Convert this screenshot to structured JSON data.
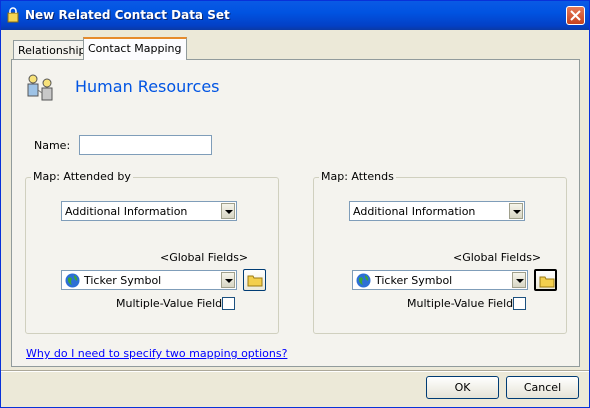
{
  "window": {
    "title": "New Related Contact Data Set",
    "close_glyph": "✕"
  },
  "tabs": [
    {
      "label": "Relationship",
      "active": false
    },
    {
      "label": "Contact Mapping",
      "active": true
    }
  ],
  "heading": "Human Resources",
  "name_field": {
    "label": "Name:",
    "value": ""
  },
  "left_group": {
    "title": "Map: Attended by",
    "combo1_value": "Additional Information",
    "fields_label": "<Global Fields>",
    "combo2_value": "Ticker Symbol",
    "multi_label": "Multiple-Value Fields",
    "multi_checked": false
  },
  "right_group": {
    "title": "Map: Attends",
    "combo1_value": "Additional Information",
    "fields_label": "<Global Fields>",
    "combo2_value": "Ticker Symbol",
    "multi_label": "Multiple-Value Fields",
    "multi_checked": false
  },
  "help_link": "Why do I need to specify two mapping options?",
  "buttons": {
    "ok": "OK",
    "cancel": "Cancel"
  },
  "icons": {
    "app": "app-lock-icon",
    "heading": "human-resources-icon",
    "field": "globe-icon",
    "folder": "folder-icon"
  },
  "colors": {
    "title_bar": "#0053e1",
    "heading": "#0054e3",
    "link": "#0000ff"
  }
}
